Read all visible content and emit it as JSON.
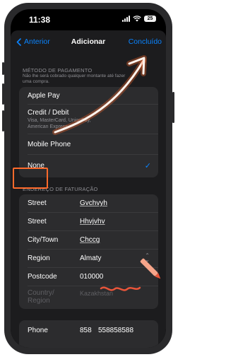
{
  "status_bar": {
    "time": "11:38",
    "battery": "25"
  },
  "nav": {
    "back_label": "Anterior",
    "title": "Adicionar",
    "done_label": "Concluído"
  },
  "payment": {
    "header": "MÉTODO DE PAGAMENTO",
    "note": "Não lhe será cobrado qualquer montante até fazer uma compra.",
    "options": [
      {
        "label": "Apple Pay",
        "sub": ""
      },
      {
        "label": "Credit / Debit",
        "sub": "Visa, MasterCard, UnionPay, American Express"
      },
      {
        "label": "Mobile Phone",
        "sub": ""
      },
      {
        "label": "None",
        "sub": "",
        "selected": true
      }
    ]
  },
  "billing": {
    "header": "ENDEREÇO DE FATURAÇÃO",
    "fields": [
      {
        "label": "Street",
        "value": "Gvchvyh"
      },
      {
        "label": "Street",
        "value": "Hhvjvhv"
      },
      {
        "label": "City/Town",
        "value": "Chccg"
      },
      {
        "label": "Region",
        "value": "Almaty"
      },
      {
        "label": "Postcode",
        "value": "010000"
      },
      {
        "label": "Country/ Region",
        "value": "Kazakhstan"
      }
    ],
    "phone": {
      "label": "Phone",
      "code": "858",
      "number": "558858588"
    }
  },
  "colors": {
    "accent": "#0a84ff",
    "annotation": "#ff6a2b",
    "background": "#1c1c1e",
    "cell": "#2c2c2e"
  }
}
